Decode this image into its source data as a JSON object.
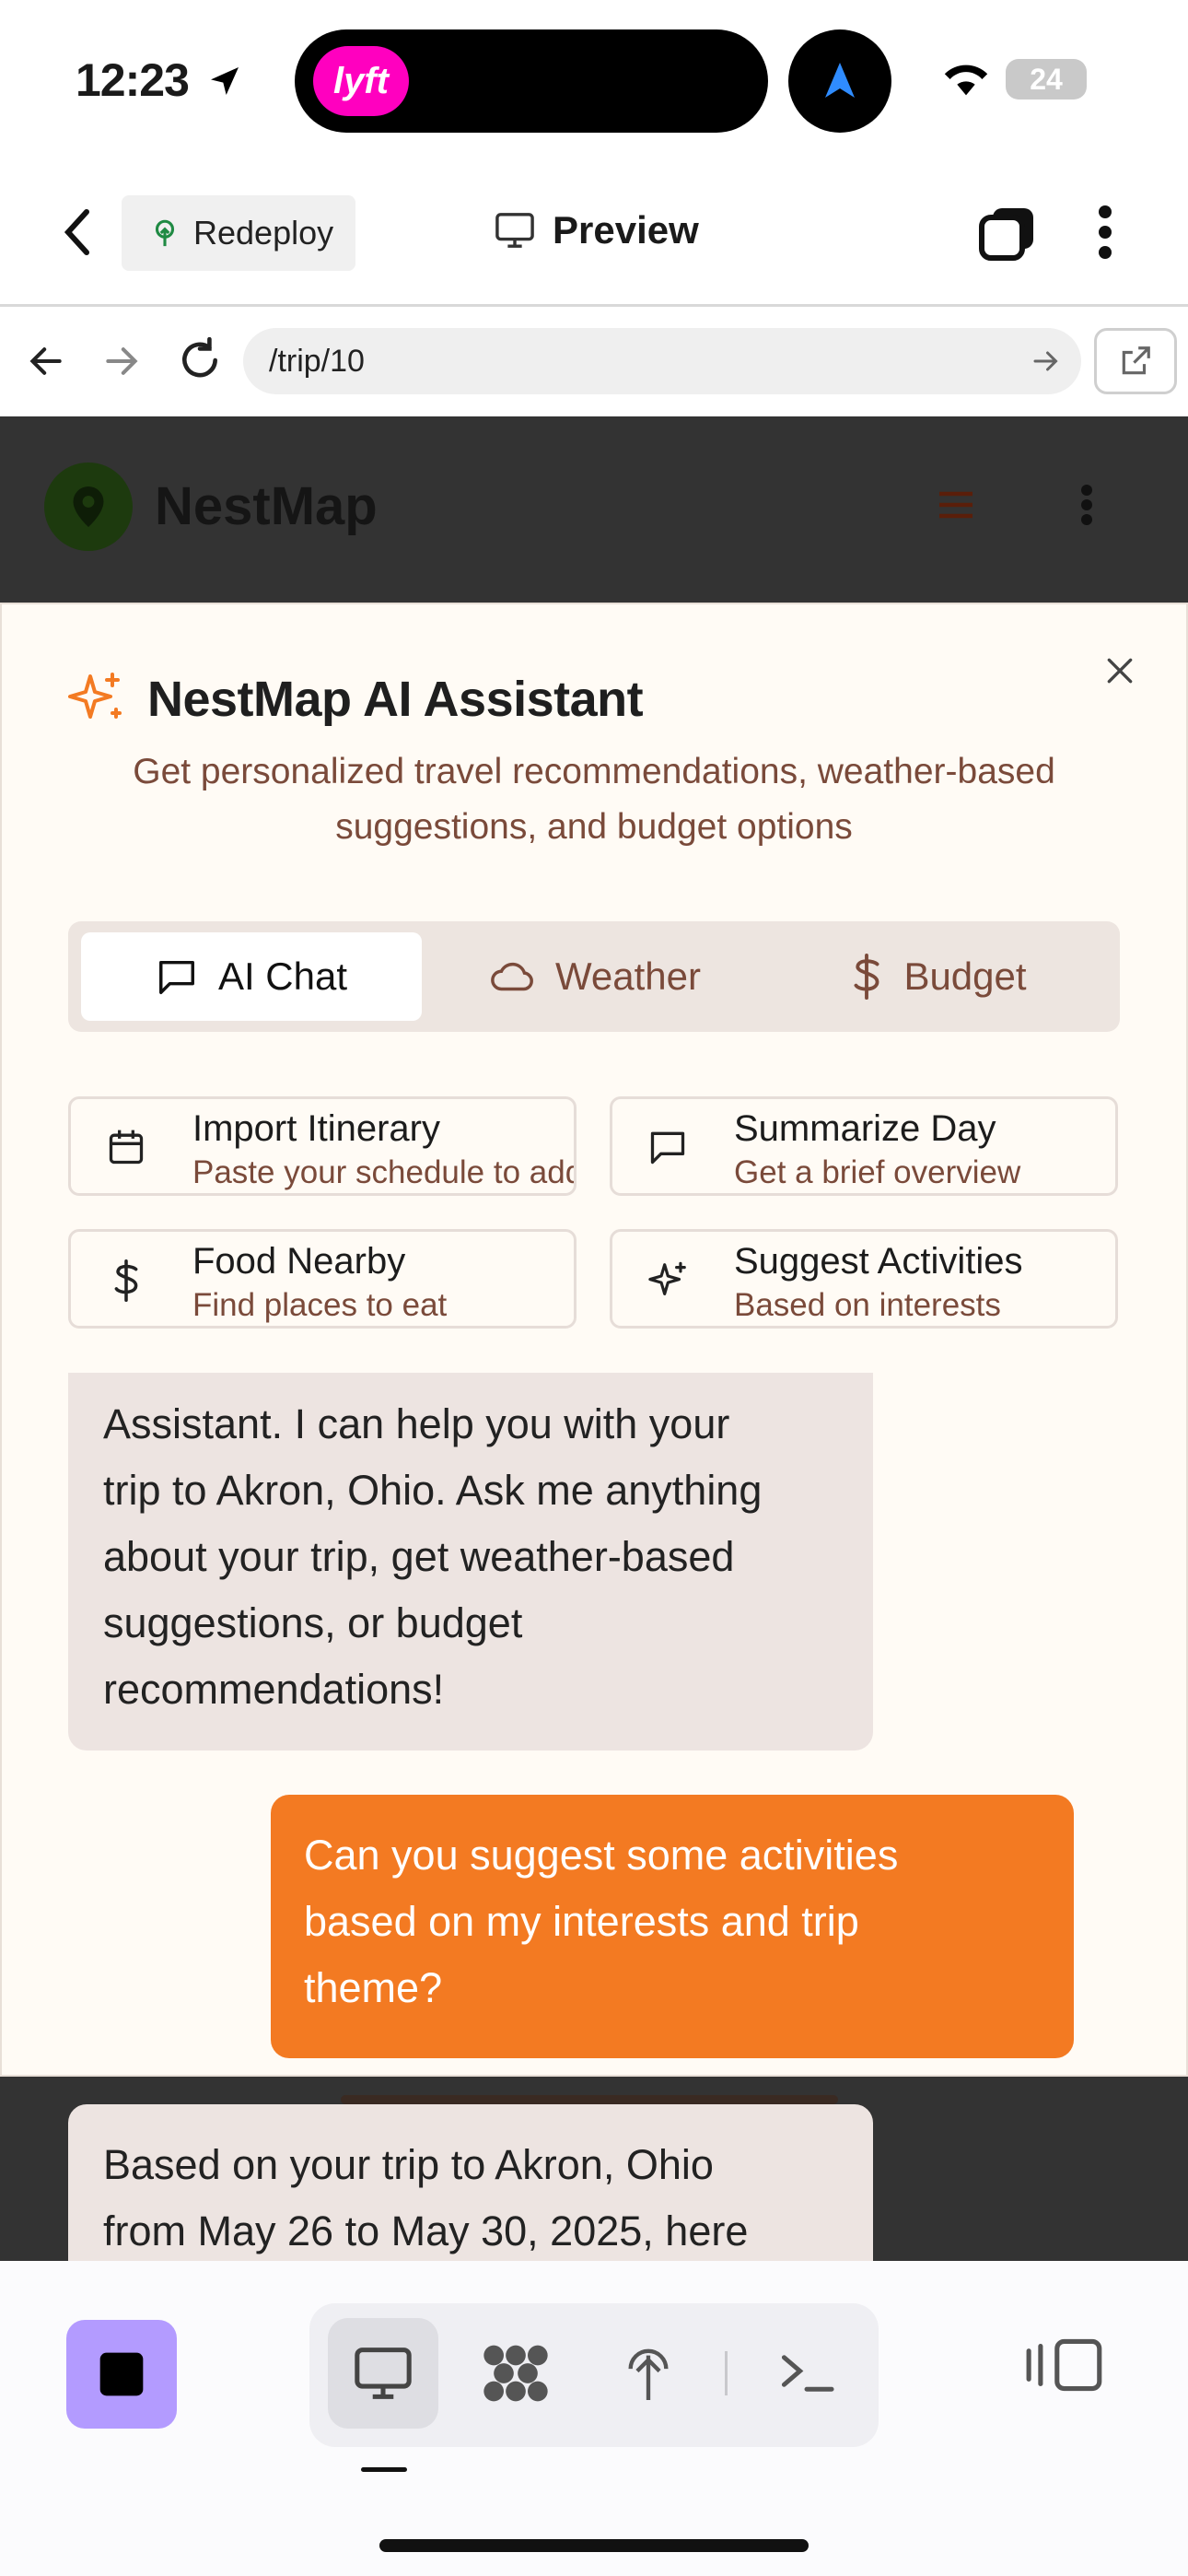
{
  "status_bar": {
    "time": "12:23",
    "lyft_label": "lyft",
    "battery": "24"
  },
  "header": {
    "redeploy_label": "Redeploy",
    "preview_label": "Preview"
  },
  "url_bar": {
    "url": "/trip/10"
  },
  "app": {
    "name": "NestMap"
  },
  "assistant": {
    "title": "NestMap AI Assistant",
    "subtitle_line1": "Get personalized travel recommendations, weather-based",
    "subtitle_line2": "suggestions, and budget options",
    "tabs": [
      {
        "label": "AI Chat",
        "icon": "chat-icon",
        "active": true
      },
      {
        "label": "Weather",
        "icon": "cloud-icon",
        "active": false
      },
      {
        "label": "Budget",
        "icon": "dollar-icon",
        "active": false
      }
    ],
    "quick_actions": [
      {
        "title": "Import Itinerary",
        "subtitle": "Paste your schedule to add",
        "icon": "calendar-icon"
      },
      {
        "title": "Summarize Day",
        "subtitle": "Get a brief overview",
        "icon": "chat-icon"
      },
      {
        "title": "Food Nearby",
        "subtitle": "Find places to eat",
        "icon": "dollar-icon"
      },
      {
        "title": "Suggest Activities",
        "subtitle": "Based on interests",
        "icon": "sparkles-icon"
      }
    ]
  },
  "chat": {
    "ai_message_1": [
      "Assistant. I can help you with your",
      "trip to Akron, Ohio. Ask me anything",
      "about your trip, get weather-based",
      "suggestions, or budget",
      "recommendations!"
    ],
    "user_message": [
      "Can you suggest some activities",
      "based on my interests and trip",
      "theme?"
    ],
    "ai_message_2": [
      "Based on your trip to Akron, Ohio",
      "from May 26 to May 30, 2025, here"
    ]
  },
  "colors": {
    "accent": "#f37a22",
    "brown_text": "#7a4a3a",
    "stop_button": "#b39bff"
  }
}
